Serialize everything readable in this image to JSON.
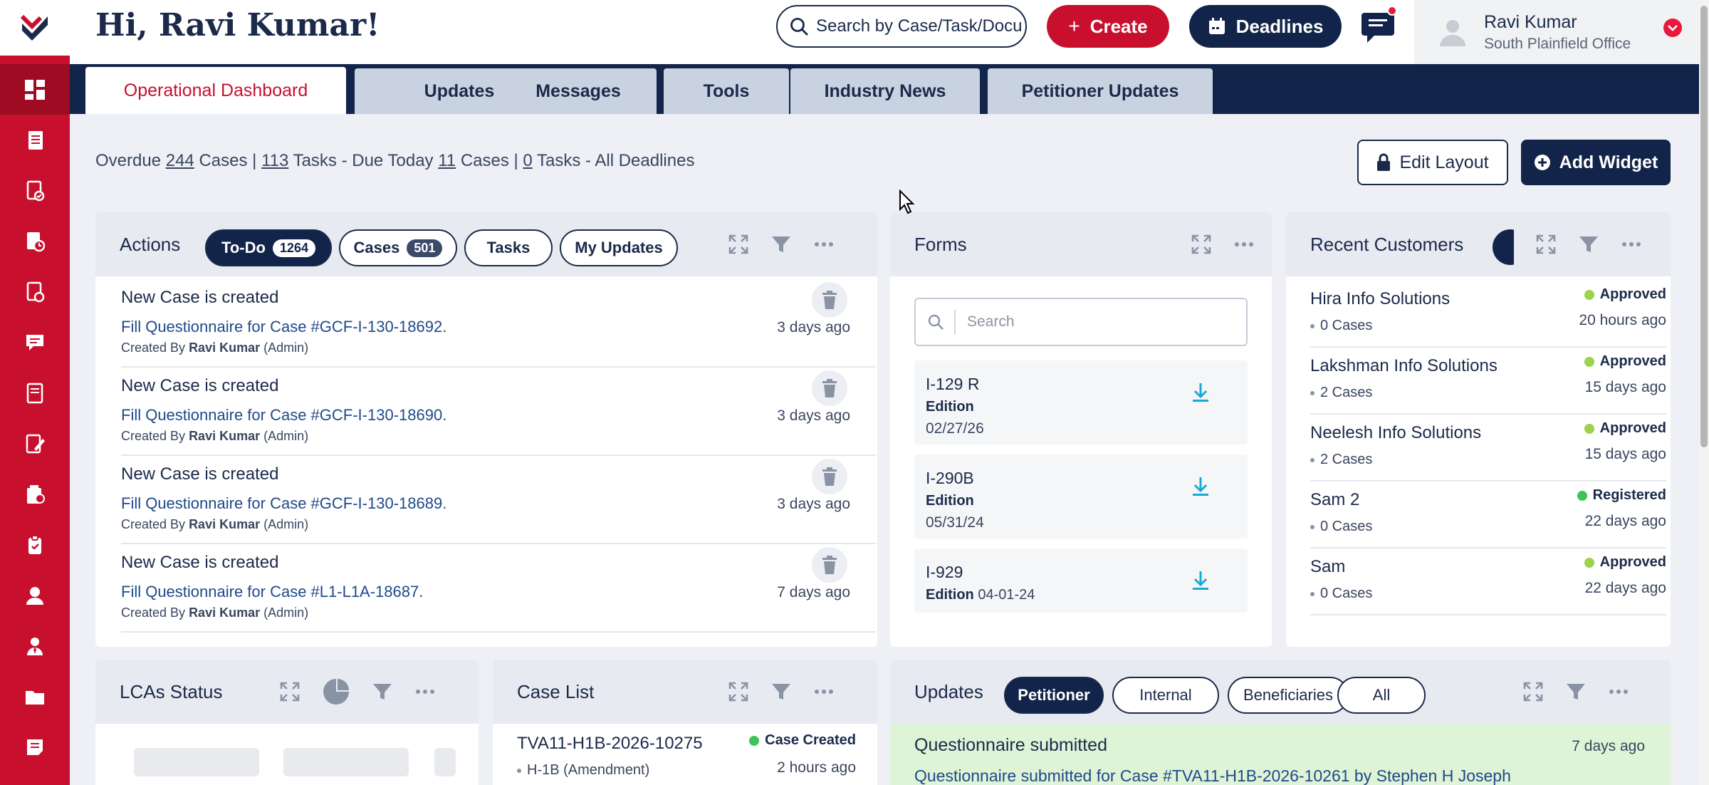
{
  "header": {
    "greeting": "Hi, Ravi Kumar!",
    "search_placeholder": "Search by Case/Task/Docu",
    "create_label": "Create",
    "deadlines_label": "Deadlines",
    "user_name": "Ravi Kumar",
    "user_office": "South Plainfield Office"
  },
  "tabs": [
    "Operational Dashboard",
    "Updates",
    "Messages",
    "Tools",
    "Industry News",
    "Petitioner Updates"
  ],
  "summary": {
    "overdue_prefix": "Overdue",
    "overdue_cases": "244",
    "cases_word": "Cases |",
    "overdue_tasks": "113",
    "due_today_text": "Tasks - Due Today",
    "due_cases": "11",
    "cases_word2": "Cases |",
    "due_tasks": "0",
    "all_deadlines": "Tasks - All Deadlines"
  },
  "toolbar": {
    "edit_layout": "Edit Layout",
    "add_widget": "Add Widget"
  },
  "actions_widget": {
    "title": "Actions",
    "filters": [
      {
        "label": "To-Do",
        "count": "1264"
      },
      {
        "label": "Cases",
        "count": "501"
      },
      {
        "label": "Tasks"
      },
      {
        "label": "My Updates"
      }
    ],
    "items": [
      {
        "title": "New Case is created",
        "link": "Fill Questionnaire for Case #GCF-I-130-18692.",
        "by_prefix": "Created By",
        "by_name": "Ravi Kumar",
        "by_role": "(Admin)",
        "time": "3 days ago"
      },
      {
        "title": "New Case is created",
        "link": "Fill Questionnaire for Case #GCF-I-130-18690.",
        "by_prefix": "Created By",
        "by_name": "Ravi Kumar",
        "by_role": "(Admin)",
        "time": "3 days ago"
      },
      {
        "title": "New Case is created",
        "link": "Fill Questionnaire for Case #GCF-I-130-18689.",
        "by_prefix": "Created By",
        "by_name": "Ravi Kumar",
        "by_role": "(Admin)",
        "time": "3 days ago"
      },
      {
        "title": "New Case is created",
        "link": "Fill Questionnaire for Case #L1-L1A-18687.",
        "by_prefix": "Created By",
        "by_name": "Ravi Kumar",
        "by_role": "(Admin)",
        "time": "7 days ago"
      }
    ]
  },
  "forms_widget": {
    "title": "Forms",
    "search_placeholder": "Search",
    "items": [
      {
        "name": "I-129 R",
        "edition_label": "Edition",
        "date": "02/27/26"
      },
      {
        "name": "I-290B",
        "edition_label": "Edition",
        "date": "05/31/24"
      },
      {
        "name": "I-929",
        "edition_label": "Edition",
        "date": "04-01-24"
      }
    ]
  },
  "customers_widget": {
    "title": "Recent Customers",
    "items": [
      {
        "name": "Hira Info Solutions",
        "cases": "0 Cases",
        "status": "Approved",
        "time": "20 hours ago"
      },
      {
        "name": "Lakshman Info Solutions",
        "cases": "2 Cases",
        "status": "Approved",
        "time": "15 days ago"
      },
      {
        "name": "Neelesh Info Solutions",
        "cases": "2 Cases",
        "status": "Approved",
        "time": "15 days ago"
      },
      {
        "name": "Sam 2",
        "cases": "0 Cases",
        "status": "Registered",
        "time": "22 days ago"
      },
      {
        "name": "Sam",
        "cases": "0 Cases",
        "status": "Approved",
        "time": "22 days ago"
      }
    ]
  },
  "lca_widget": {
    "title": "LCAs Status"
  },
  "caselist_widget": {
    "title": "Case List",
    "items": [
      {
        "case": "TVA11-H1B-2026-10275",
        "type": "H-1B (Amendment)",
        "status": "Case Created",
        "time": "2 hours ago"
      }
    ]
  },
  "updates_widget": {
    "title": "Updates",
    "filters": [
      "Petitioner",
      "Internal",
      "Beneficiaries",
      "All"
    ],
    "items": [
      {
        "title": "Questionnaire submitted",
        "text": "Questionnaire submitted for Case #TVA11-H1B-2026-10261 by Stephen H Joseph",
        "time": "7 days ago"
      }
    ]
  },
  "colors": {
    "brand_red": "#c8102e",
    "navy": "#13244a",
    "approved_green": "#9bd34a",
    "registered_green": "#3cc45a"
  }
}
